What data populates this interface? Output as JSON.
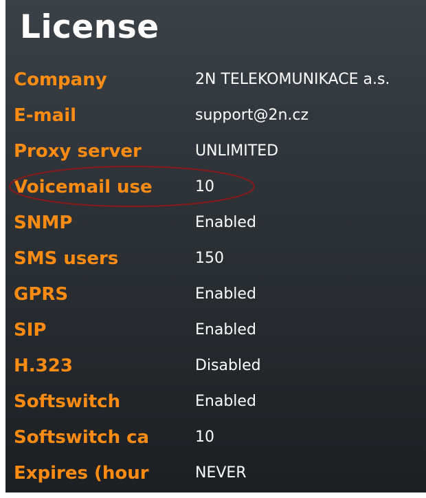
{
  "title": "License",
  "rows": [
    {
      "label": "Company",
      "value": "2N TELEKOMUNIKACE a.s."
    },
    {
      "label": "E-mail",
      "value": "support@2n.cz"
    },
    {
      "label": "Proxy server",
      "value": "UNLIMITED"
    },
    {
      "label": "Voicemail use",
      "value": "10"
    },
    {
      "label": "SNMP",
      "value": "Enabled"
    },
    {
      "label": "SMS users",
      "value": "150"
    },
    {
      "label": "GPRS",
      "value": "Enabled"
    },
    {
      "label": "SIP",
      "value": "Enabled"
    },
    {
      "label": "H.323",
      "value": "Disabled"
    },
    {
      "label": "Softswitch",
      "value": "Enabled"
    },
    {
      "label": "Softswitch ca",
      "value": "10"
    },
    {
      "label": "Expires (hour",
      "value": "NEVER"
    }
  ],
  "colors": {
    "label": "#ff8c12",
    "value": "#ffffff",
    "highlight_ellipse": "#8b1a1a"
  }
}
